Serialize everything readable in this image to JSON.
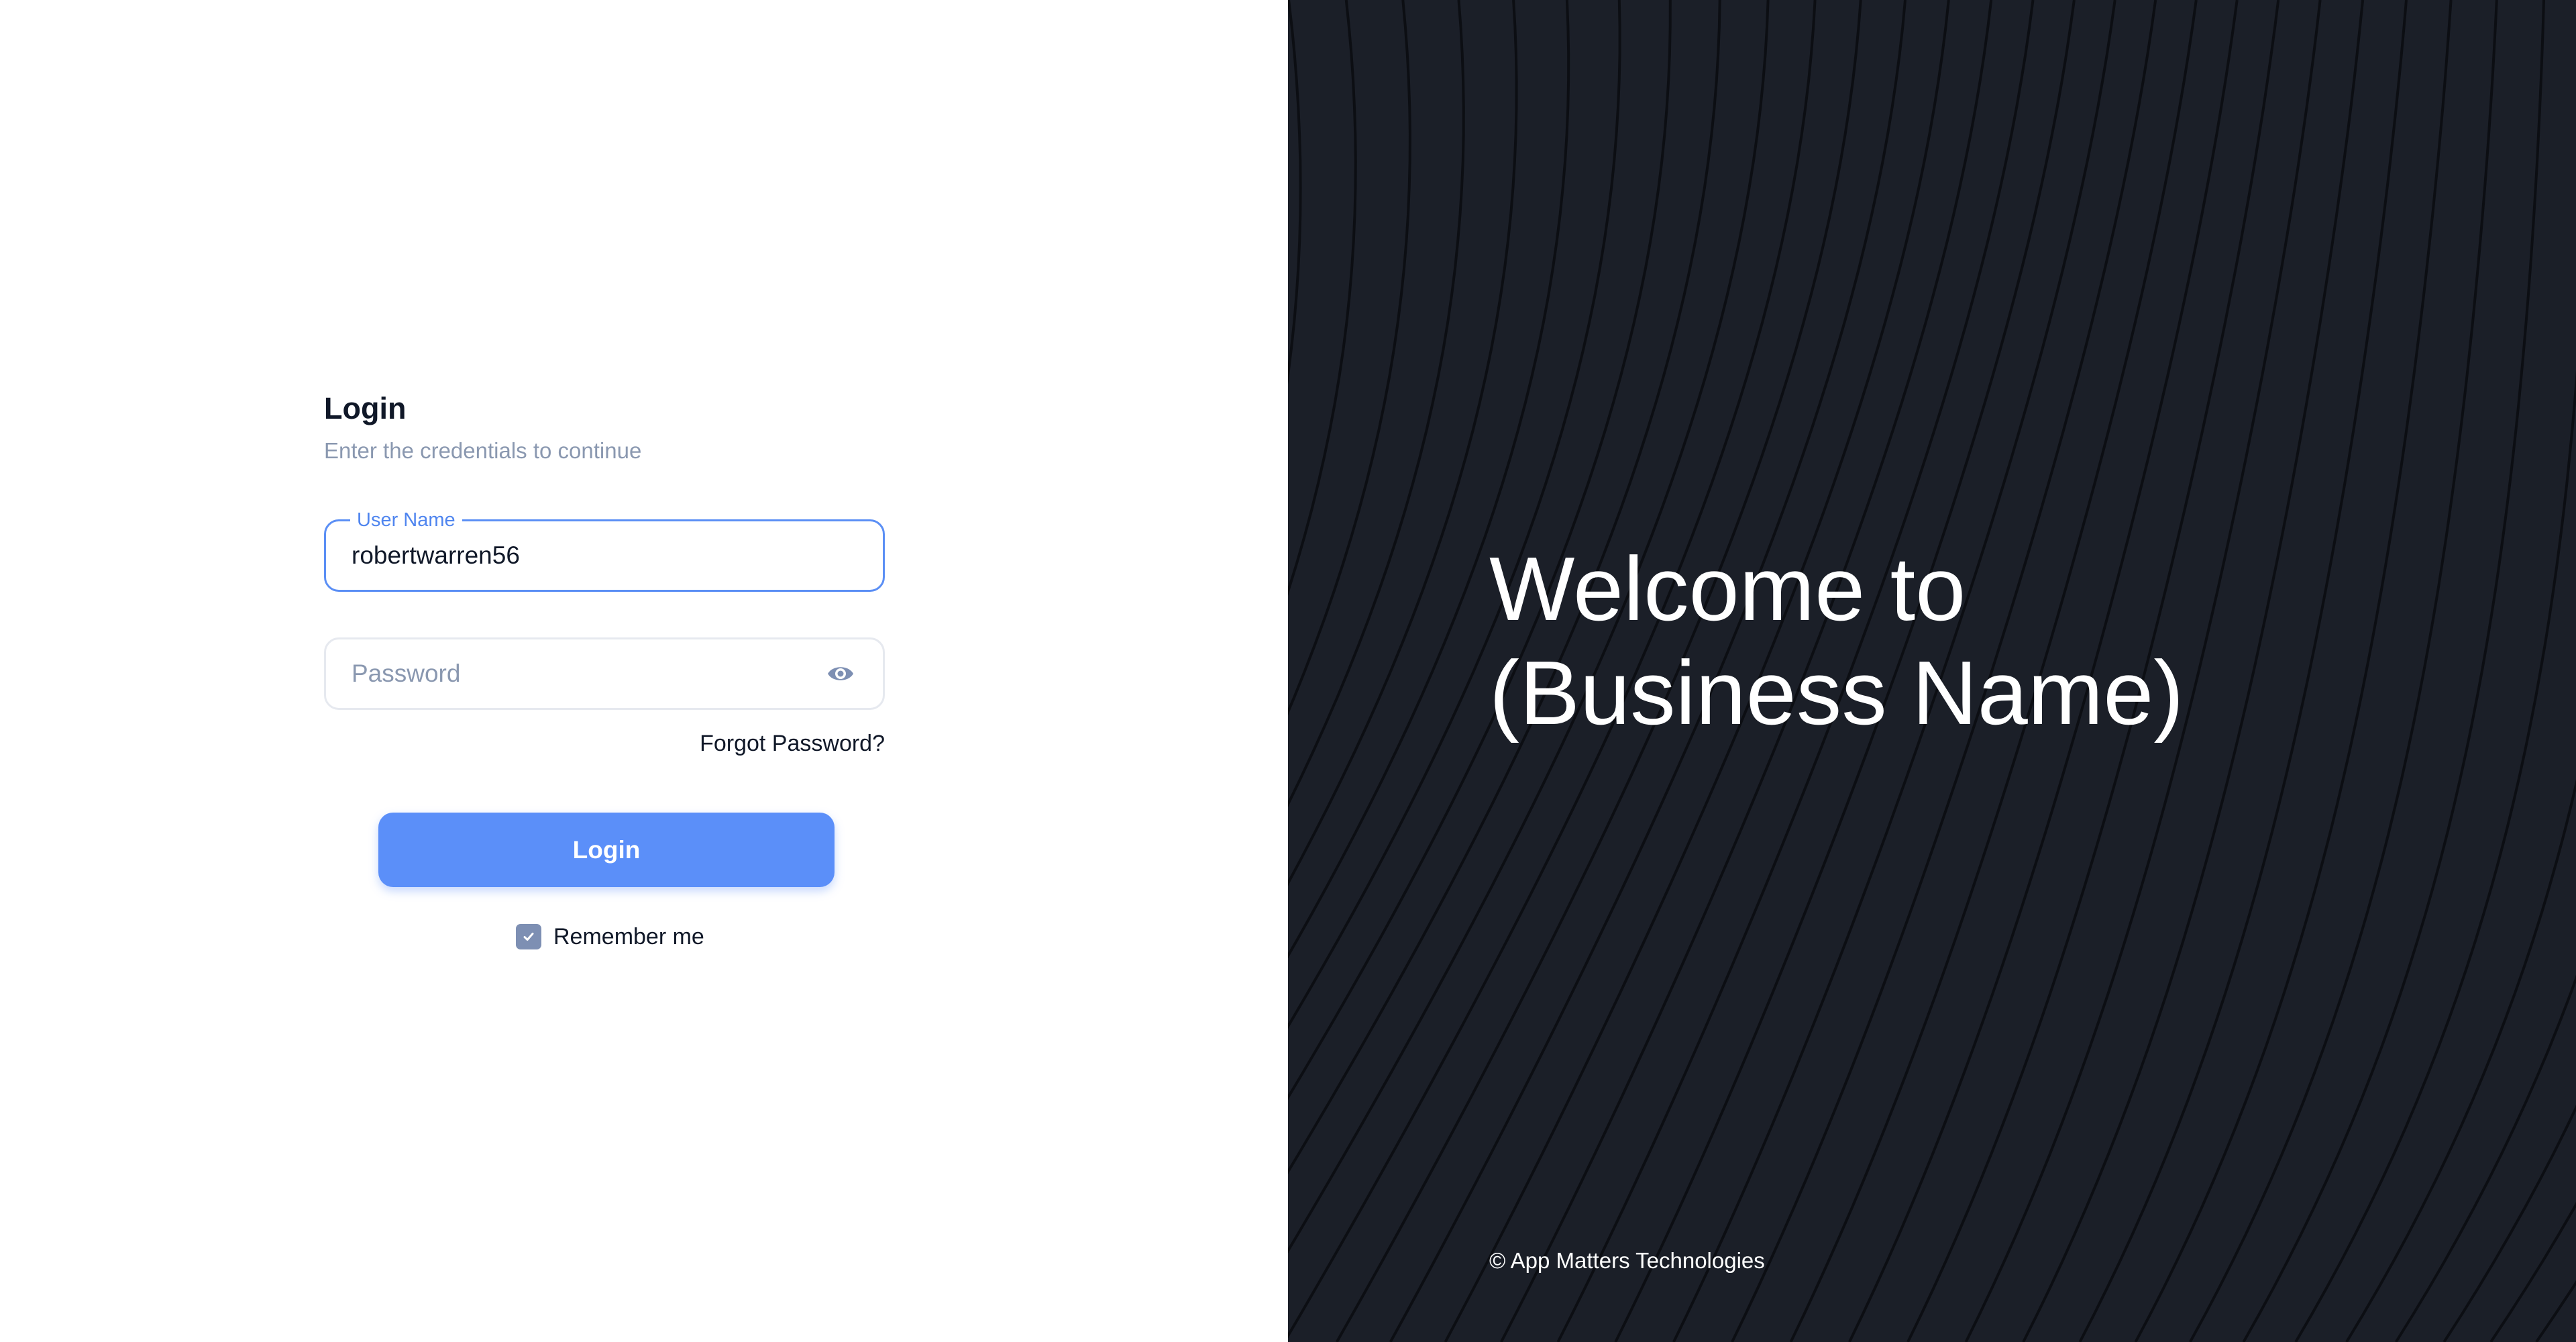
{
  "login": {
    "title": "Login",
    "subtitle": "Enter the credentials to continue",
    "username": {
      "label": "User Name",
      "value": "robertwarren56"
    },
    "password": {
      "placeholder": "Password",
      "value": ""
    },
    "forgot_password": "Forgot Password?",
    "submit_label": "Login",
    "remember_me": {
      "label": "Remember me",
      "checked": true
    }
  },
  "hero": {
    "welcome_line1": "Welcome to",
    "welcome_line2": "(Business Name)",
    "copyright": "© App Matters Technologies"
  },
  "icons": {
    "password_toggle": "eye-icon",
    "checkbox_mark": "check-icon"
  },
  "colors": {
    "accent": "#5b8ff9",
    "focus_border": "#5b8ff5",
    "dark_panel": "#1b1f28",
    "muted_text": "#8a98b0",
    "checkbox": "#7d8fb3"
  }
}
